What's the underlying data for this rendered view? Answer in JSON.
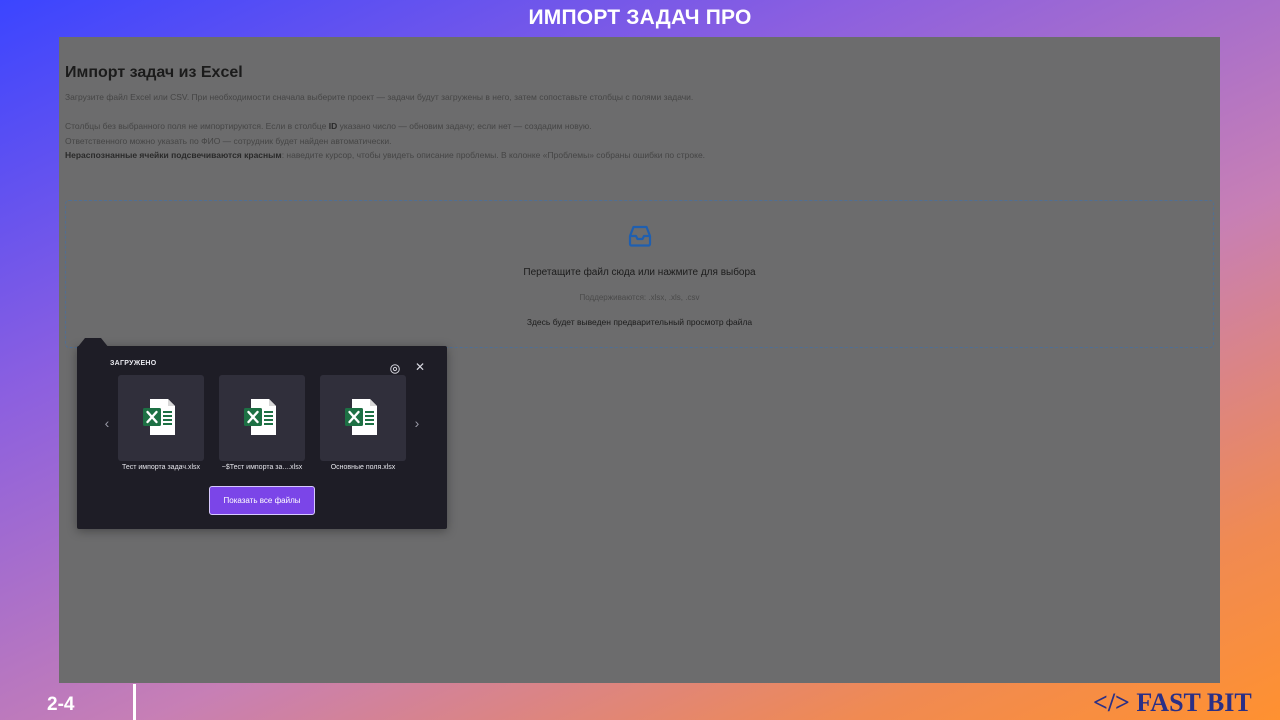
{
  "slide": {
    "title": "ИМПОРТ ЗАДАЧ ПРО",
    "page_number": "2-4",
    "brand": "</> FAST BIT"
  },
  "page": {
    "heading": "Импорт задач из Excel",
    "desc_line1": "Загрузите файл Excel или CSV. При необходимости сначала выберите проект — задачи будут загружены в него, затем сопоставьте столбцы с полями задачи.",
    "desc_line2_a": "Столбцы без выбранного поля не импортируются. Если в столбце ",
    "desc_line2_bold": "ID",
    "desc_line2_b": " указано число — обновим задачу; если нет — создадим новую.",
    "desc_line3": "Ответственного можно указать по ФИО — сотрудник будет найден автоматически.",
    "desc_line4_bold": "Нераспознанные ячейки подсвечиваются красным",
    "desc_line4_rest": ": наведите курсор, чтобы увидеть описание проблемы. В колонке «Проблемы» собраны ошибки по строке."
  },
  "dropzone": {
    "icon": "inbox-icon",
    "main_text": "Перетащите файл сюда или нажмите для выбора",
    "supported": "Поддерживаются: .xlsx, .xls, .csv",
    "preview_text": "Здесь будет выведен предварительный просмотр файла"
  },
  "downloads_popup": {
    "title": "ЗАГРУЖЕНО",
    "files": [
      {
        "name": "Тест импорта задач.xlsx",
        "icon": "excel-icon"
      },
      {
        "name": "~$Тест импорта за....xlsx",
        "icon": "excel-icon"
      },
      {
        "name": "Основные поля.xlsx",
        "icon": "excel-icon"
      }
    ],
    "show_all_label": "Показать все файлы",
    "prev_arrow": "‹",
    "next_arrow": "›",
    "close_glyph": "✕"
  },
  "colors": {
    "accent": "#7b45e8",
    "excel_green": "#1d7044",
    "overlay_gray": "#6c6c6d",
    "brand_navy": "#2a2f86"
  }
}
